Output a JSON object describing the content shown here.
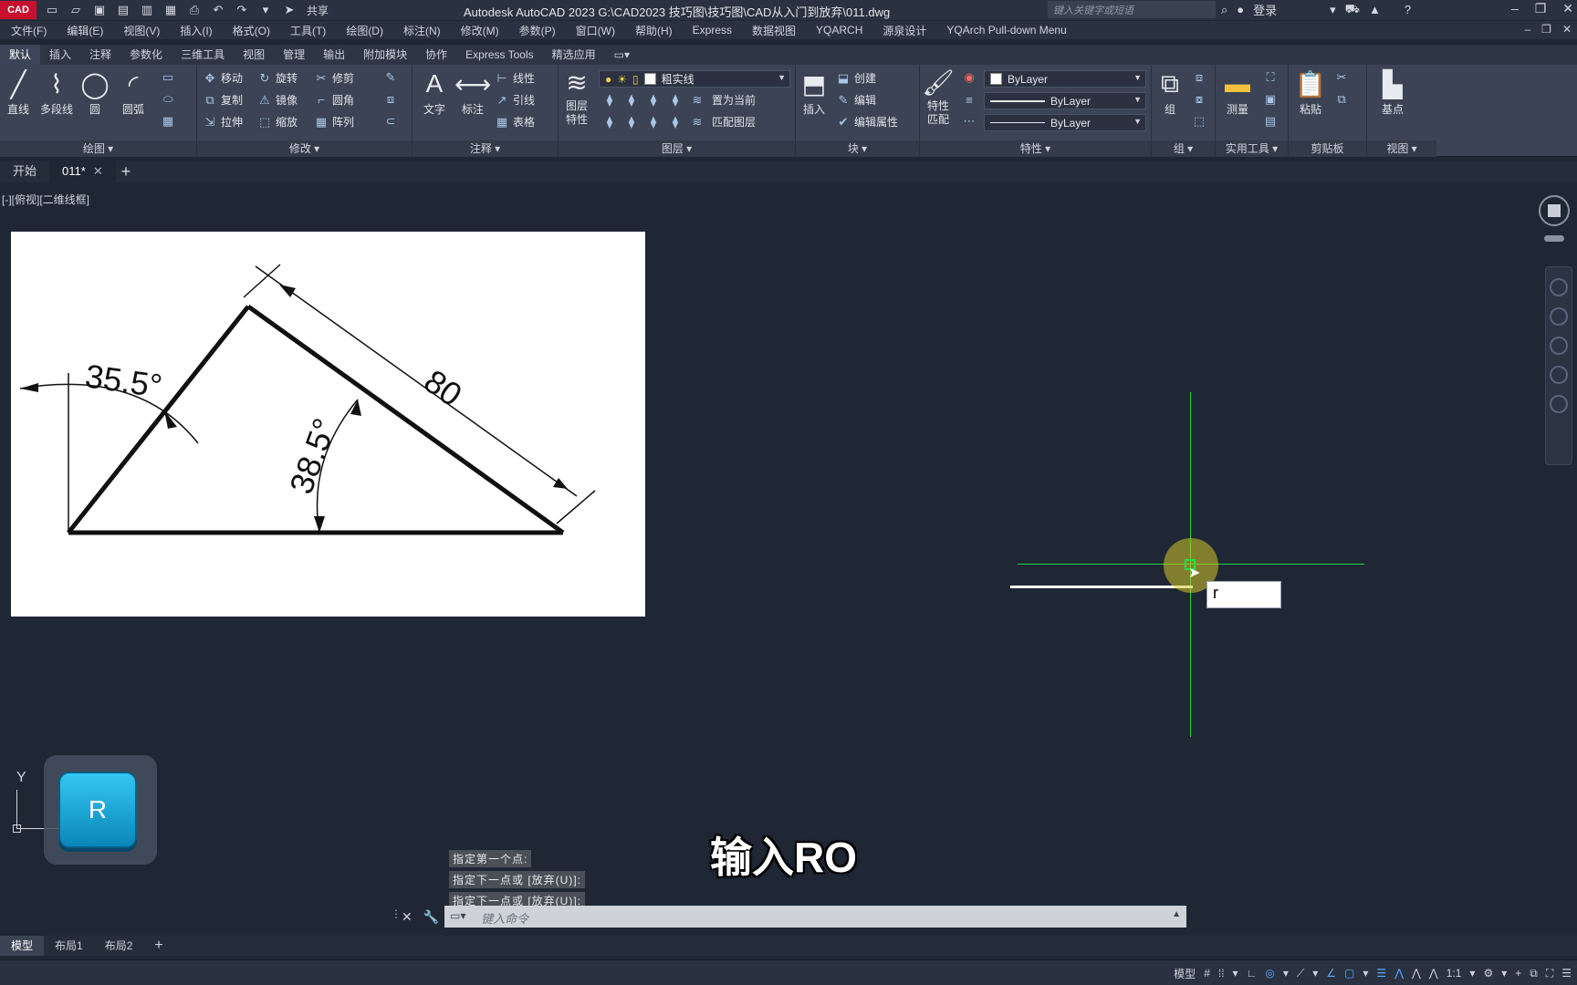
{
  "app": {
    "logo": "CAD",
    "title": "Autodesk AutoCAD 2023    G:\\CAD2023 技巧图\\技巧图\\CAD从入门到放弃\\011.dwg",
    "share_label": "共享",
    "search_placeholder": "键入关键字或短语",
    "login_label": "登录"
  },
  "menu": [
    "文件(F)",
    "编辑(E)",
    "视图(V)",
    "插入(I)",
    "格式(O)",
    "工具(T)",
    "绘图(D)",
    "标注(N)",
    "修改(M)",
    "参数(P)",
    "窗口(W)",
    "帮助(H)",
    "Express",
    "数据视图",
    "YQARCH",
    "源泉设计",
    "YQArch Pull-down Menu"
  ],
  "ribbon_tabs": [
    "默认",
    "插入",
    "注释",
    "参数化",
    "三维工具",
    "视图",
    "管理",
    "输出",
    "附加模块",
    "协作",
    "Express Tools",
    "精选应用"
  ],
  "ribbon": {
    "draw": {
      "label": "绘图",
      "line": "直线",
      "polyline": "多段线",
      "circle": "圆",
      "arc": "圆弧"
    },
    "modify": {
      "label": "修改",
      "move": "移动",
      "rotate": "旋转",
      "trim": "修剪",
      "copy": "复制",
      "mirror": "镜像",
      "fillet": "圆角",
      "stretch": "拉伸",
      "scale": "缩放",
      "array": "阵列"
    },
    "annotation": {
      "label": "注释",
      "text": "文字",
      "dimension": "标注",
      "linear": "线性",
      "leader": "引线",
      "table": "表格"
    },
    "layers": {
      "label": "图层",
      "properties": "图层\n特性",
      "current_layer": "粗实线",
      "set_current": "置为当前",
      "match_layer": "匹配图层"
    },
    "block": {
      "label": "块",
      "insert": "插入",
      "create": "创建",
      "edit": "编辑",
      "edit_attr": "编辑属性"
    },
    "properties": {
      "label": "特性",
      "match": "特性\n匹配",
      "color": "ByLayer",
      "lineweight": "ByLayer",
      "linetype": "ByLayer"
    },
    "groups": {
      "label": "组",
      "group": "组"
    },
    "utilities": {
      "label": "实用工具",
      "measure": "测量"
    },
    "clipboard": {
      "label": "剪贴板",
      "paste": "粘贴"
    },
    "view": {
      "label": "视图",
      "base": "基点"
    }
  },
  "file_tabs": [
    {
      "label": "开始"
    },
    {
      "label": "011*"
    }
  ],
  "viewport": {
    "label": "[-][俯视][二维线框]",
    "dynamic_input_value": "r",
    "key_badge": "R",
    "subtitle": "输入RO",
    "ucs_y": "Y"
  },
  "drawing": {
    "dim_angle_left": "35.5°",
    "dim_angle_inner": "38.5°",
    "dim_length": "80"
  },
  "command": {
    "history": [
      "指定第一个点:",
      "指定下一点或 [放弃(U)]:",
      "指定下一点或 [放弃(U)]:"
    ],
    "placeholder": "键入命令"
  },
  "layout_tabs": [
    "模型",
    "布局1",
    "布局2"
  ],
  "status": {
    "model_label": "模型",
    "scale": "1:1"
  }
}
